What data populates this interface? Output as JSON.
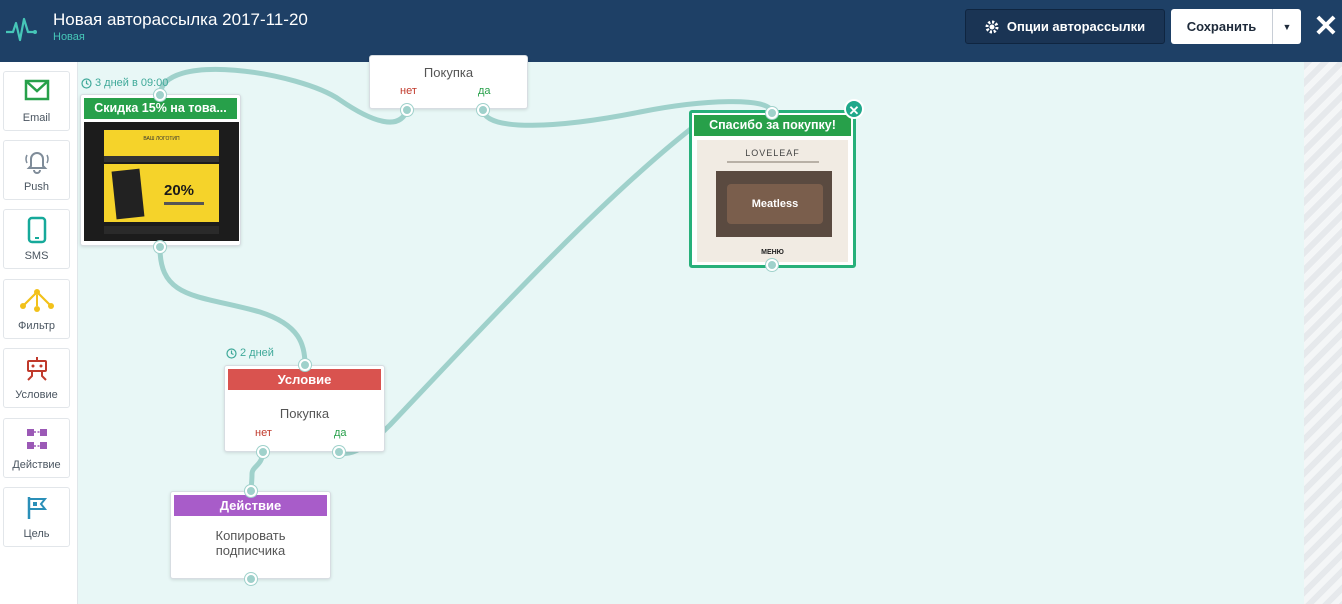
{
  "header": {
    "title": "Новая авторассылка 2017-11-20",
    "status": "Новая",
    "options_label": "Опции авторассылки",
    "save_label": "Сохранить"
  },
  "sidebar": {
    "items": [
      {
        "label": "Email",
        "icon": "envelope-icon",
        "color": "#27a04a"
      },
      {
        "label": "Push",
        "icon": "bell-icon",
        "color": "#7f8c99"
      },
      {
        "label": "SMS",
        "icon": "phone-icon",
        "color": "#16a99a"
      },
      {
        "label": "Фильтр",
        "icon": "filter-icon",
        "color": "#f2c11a"
      },
      {
        "label": "Условие",
        "icon": "condition-icon",
        "color": "#c0392b"
      },
      {
        "label": "Действие",
        "icon": "action-icon",
        "color": "#9b59b6"
      },
      {
        "label": "Цель",
        "icon": "flag-icon",
        "color": "#2a8fb8"
      }
    ]
  },
  "nodes": {
    "email1": {
      "timer": "3 дней в 09:00",
      "title": "Скидка 15% на това...",
      "color": "#27a04a",
      "thumb": {
        "logo": "ВАШ ЛОГОТИП",
        "percent": "20%"
      }
    },
    "cond_top": {
      "body": "Покупка",
      "no": "нет",
      "yes": "да"
    },
    "email2": {
      "title": "Спасибо за покупку!",
      "color": "#27a04a",
      "thumb": {
        "brand": "LOVELEAF",
        "hero": "Meatless",
        "menu": "МЕНЮ"
      }
    },
    "cond2": {
      "timer": "2 дней",
      "title": "Условие",
      "color": "#d9534f",
      "body": "Покупка",
      "no": "нет",
      "yes": "да"
    },
    "action": {
      "title": "Действие",
      "color": "#a85cc9",
      "body_line1": "Копировать",
      "body_line2": "подписчика"
    }
  },
  "colors": {
    "header": "#1e4066",
    "canvas": "#e8f7f6",
    "connector": "#9fd1cb",
    "accent": "#46c6b8"
  }
}
